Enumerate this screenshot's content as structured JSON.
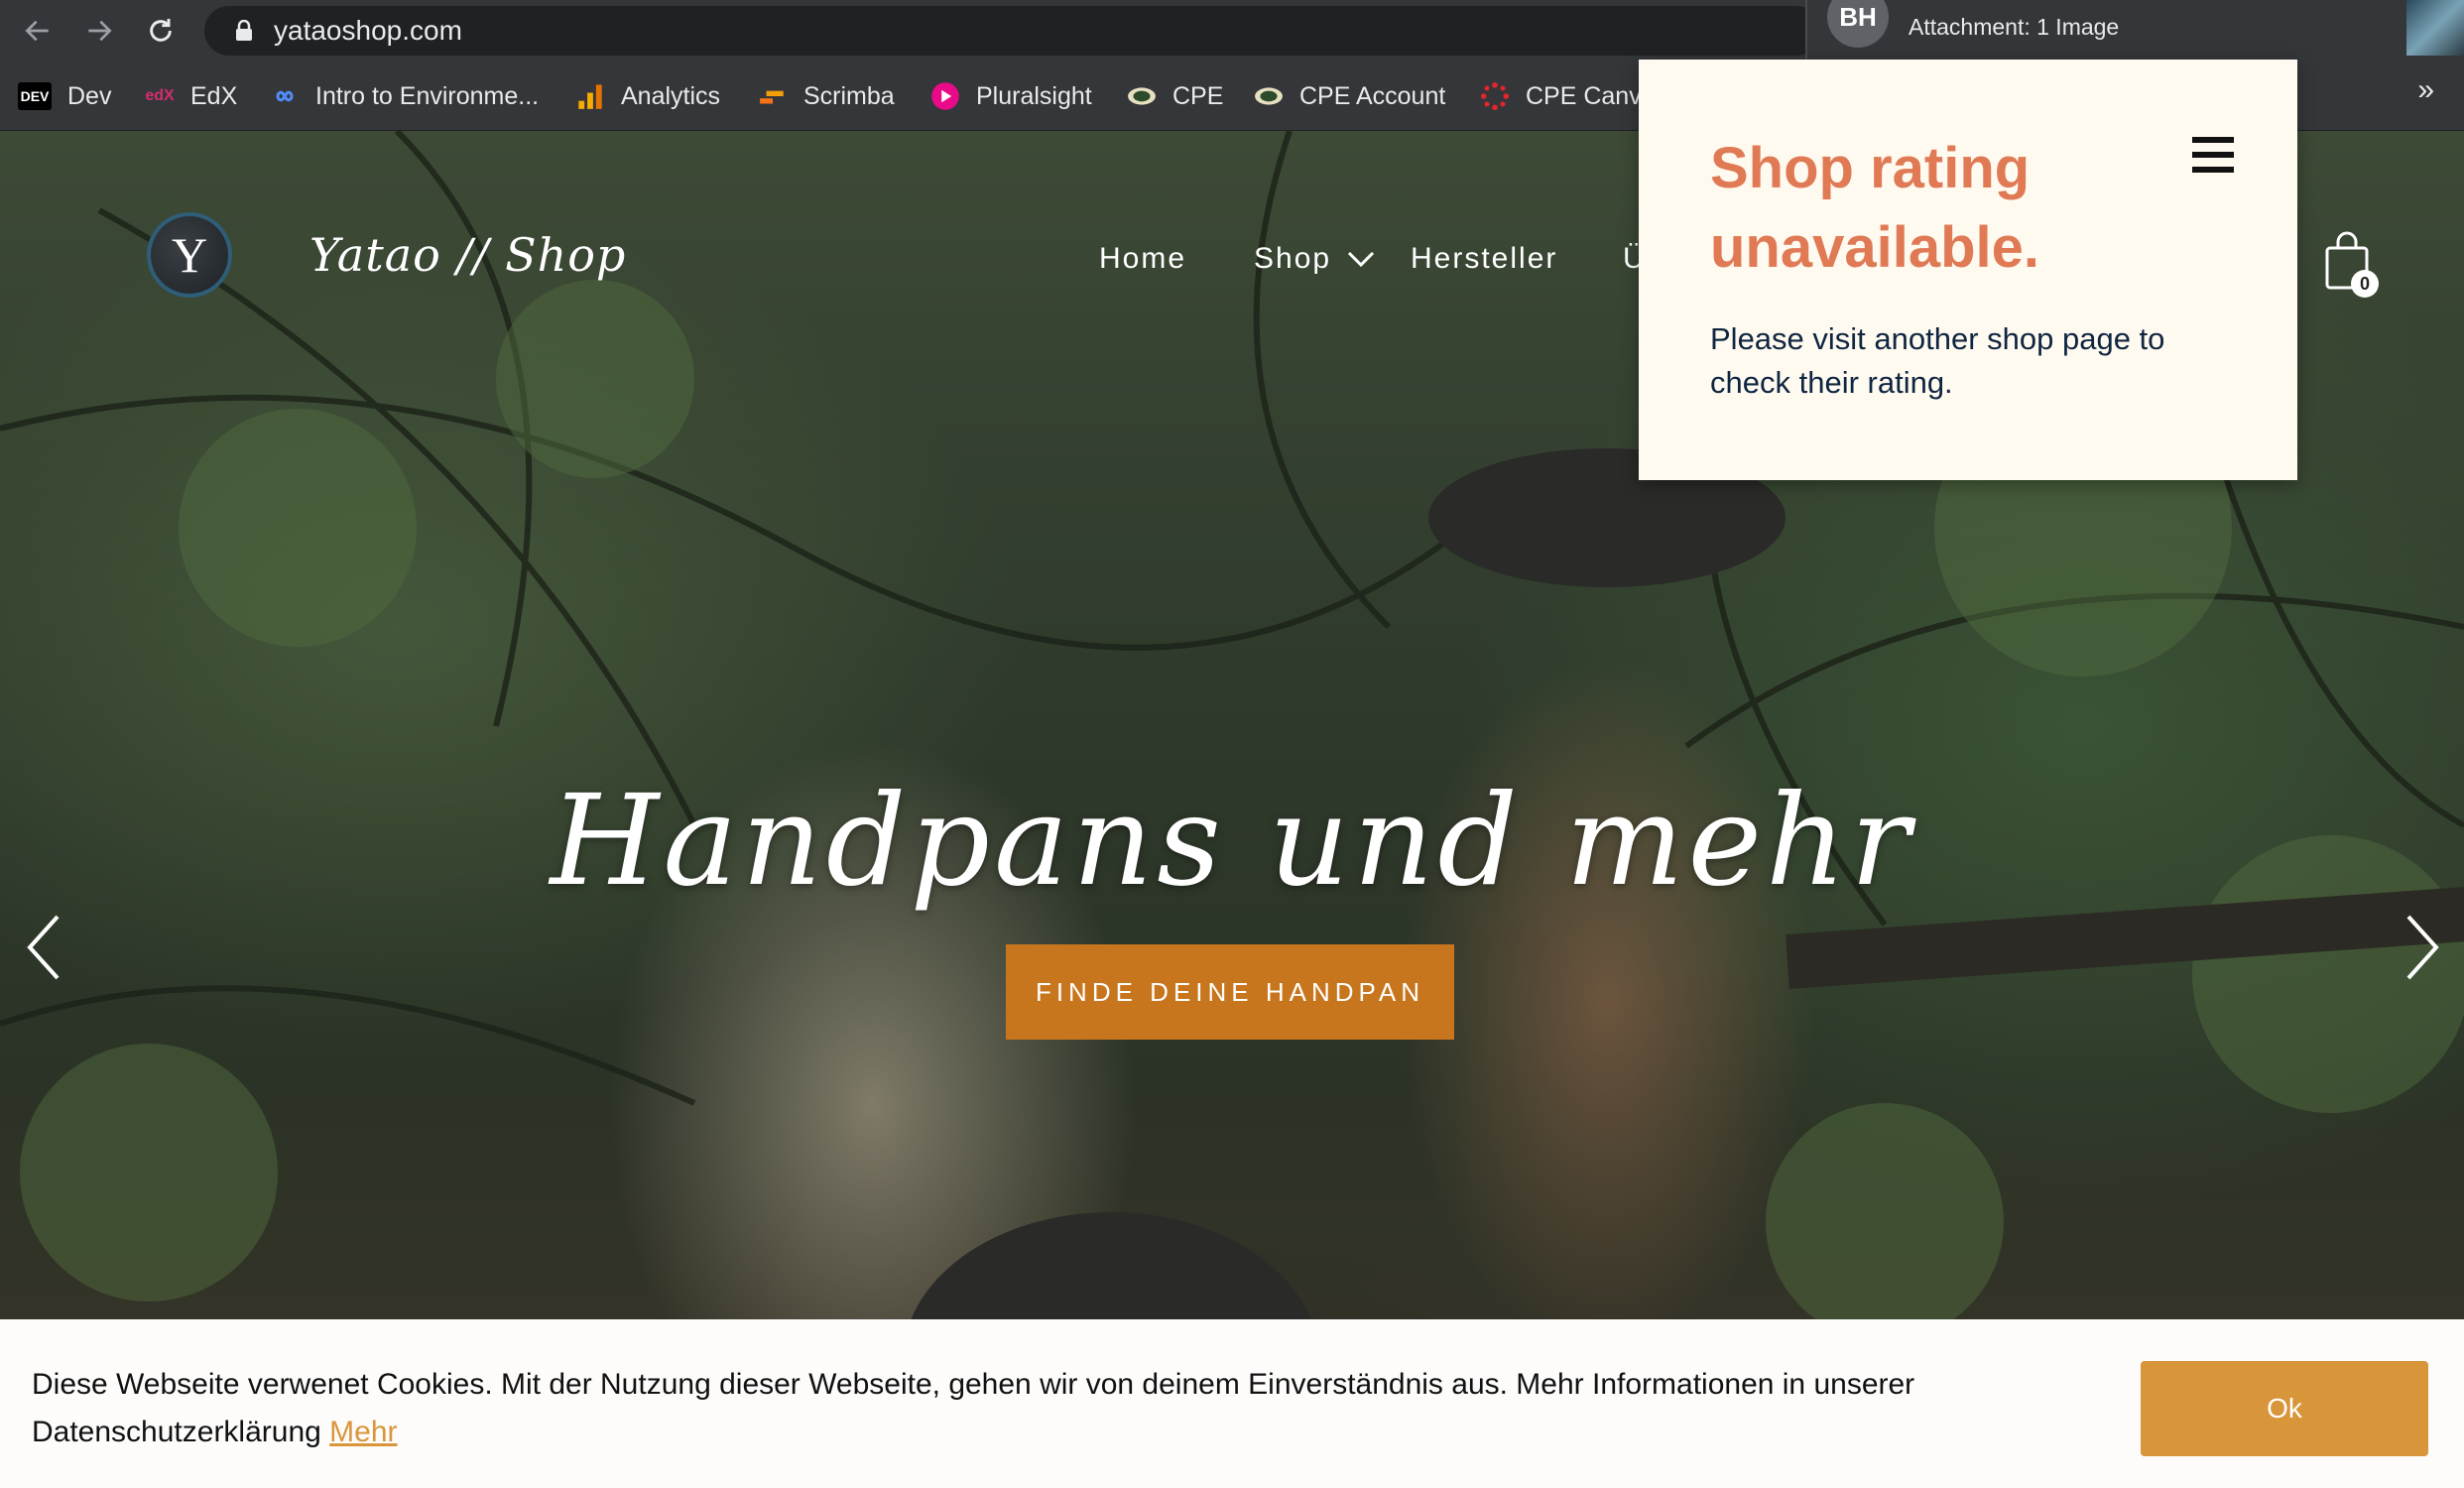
{
  "browser": {
    "url": "yataoshop.com",
    "notification": {
      "avatar_initials": "BH",
      "text": "Attachment: 1 Image"
    },
    "bookmarks": [
      {
        "label": "Dev",
        "icon": "dev-icon",
        "icon_text": "DEV"
      },
      {
        "label": "EdX",
        "icon": "edx-icon",
        "icon_text": "edX"
      },
      {
        "label": "Intro to Environme...",
        "icon": "infinity-icon",
        "icon_text": ""
      },
      {
        "label": "Analytics",
        "icon": "analytics-icon",
        "icon_text": ""
      },
      {
        "label": "Scrimba",
        "icon": "scrimba-icon",
        "icon_text": ""
      },
      {
        "label": "Pluralsight",
        "icon": "pluralsight-icon",
        "icon_text": ""
      },
      {
        "label": "CPE",
        "icon": "cpe-icon",
        "icon_text": ""
      },
      {
        "label": "CPE Account",
        "icon": "cpe-icon",
        "icon_text": ""
      },
      {
        "label": "CPE Canv",
        "icon": "canvas-icon",
        "icon_text": ""
      }
    ],
    "more": "»"
  },
  "site": {
    "logo_letter": "Y",
    "brand": "Yatao // Shop",
    "nav": [
      "Home",
      "Shop",
      "Hersteller",
      "Ü"
    ],
    "cart_count": "0",
    "headline": "Handpans und mehr",
    "cta": "FINDE DEINE HANDPAN"
  },
  "popup": {
    "title": "Shop rating unavailable.",
    "body": "Please visit another shop page to check their rating."
  },
  "cookie": {
    "text": "Diese Webseite verwenet Cookies. Mit der Nutzung dieser Webseite, gehen wir von deinem Einverständnis aus. Mehr Informationen in unserer Datenschutzerklärung",
    "link": "Mehr",
    "ok": "Ok"
  },
  "colors": {
    "cta": "#c8761e",
    "popup_title": "#e07a55",
    "cookie_accent": "#d9953a"
  }
}
